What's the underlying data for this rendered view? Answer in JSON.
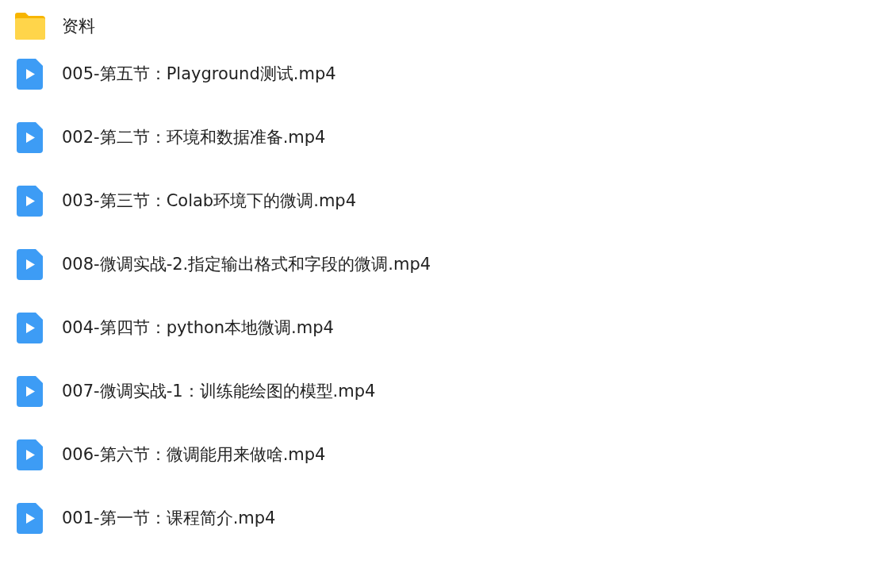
{
  "files": [
    {
      "kind": "folder",
      "name": "资料"
    },
    {
      "kind": "video",
      "name": "005-第五节：Playground测试.mp4"
    },
    {
      "kind": "video",
      "name": "002-第二节：环境和数据准备.mp4"
    },
    {
      "kind": "video",
      "name": "003-第三节：Colab环境下的微调.mp4"
    },
    {
      "kind": "video",
      "name": "008-微调实战-2.指定输出格式和字段的微调.mp4"
    },
    {
      "kind": "video",
      "name": "004-第四节：python本地微调.mp4"
    },
    {
      "kind": "video",
      "name": "007-微调实战-1：训练能绘图的模型.mp4"
    },
    {
      "kind": "video",
      "name": "006-第六节：微调能用来做啥.mp4"
    },
    {
      "kind": "video",
      "name": "001-第一节：课程简介.mp4"
    }
  ]
}
